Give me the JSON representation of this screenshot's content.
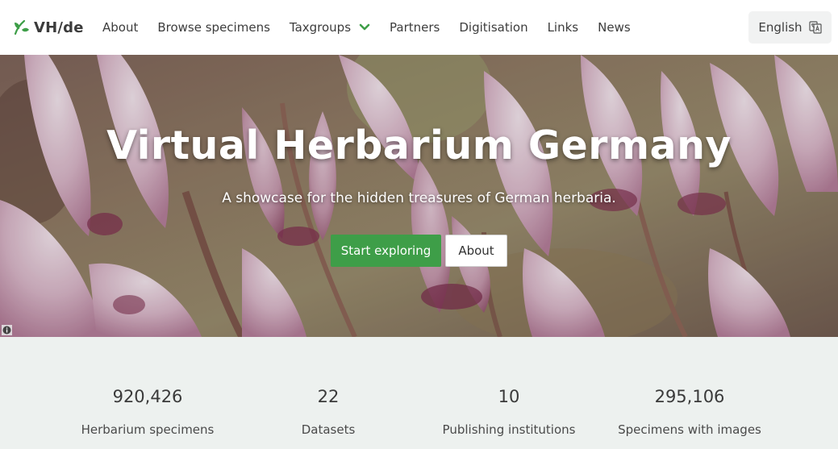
{
  "brand": {
    "name": "VH/de",
    "icon": "leaf-icon",
    "color": "#3e9e48"
  },
  "nav": {
    "items": [
      {
        "label": "About"
      },
      {
        "label": "Browse specimens"
      },
      {
        "label": "Taxgroups",
        "icon": "chevron-down-icon"
      },
      {
        "label": "Partners"
      },
      {
        "label": "Digitisation"
      },
      {
        "label": "Links"
      },
      {
        "label": "News"
      }
    ],
    "language": {
      "label": "English",
      "icon": "translate-icon"
    }
  },
  "hero": {
    "title": "Virtual Herbarium Germany",
    "subtitle": "A showcase for the hidden treasures of German herbaria.",
    "primary_button": "Start exploring",
    "secondary_button": "About",
    "info_icon": "info-icon",
    "primary_color": "#3e9e48"
  },
  "stats": [
    {
      "value": "920,426",
      "label": "Herbarium specimens"
    },
    {
      "value": "22",
      "label": "Datasets"
    },
    {
      "value": "10",
      "label": "Publishing institutions"
    },
    {
      "value": "295,106",
      "label": "Specimens with images"
    }
  ]
}
